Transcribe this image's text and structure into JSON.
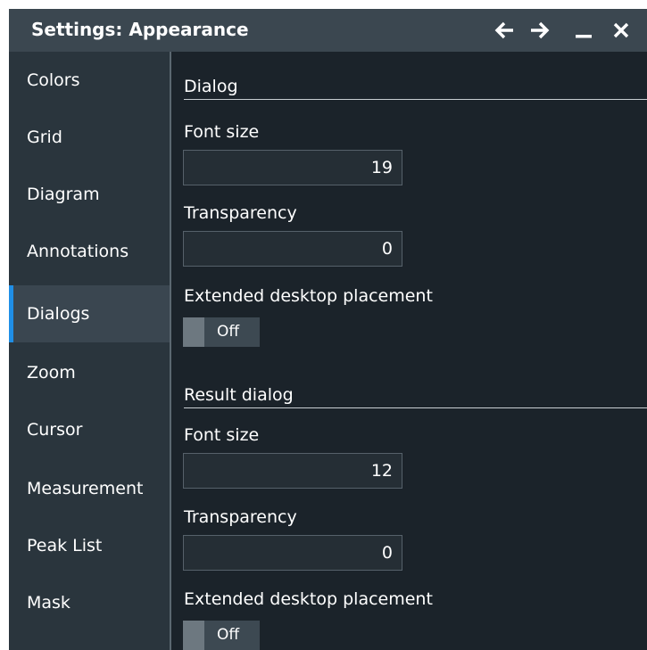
{
  "window": {
    "title": "Settings: Appearance",
    "buttons": {
      "back": "arrow-left-icon",
      "forward": "arrow-right-icon",
      "minimize": "minimize-icon",
      "close": "close-icon"
    }
  },
  "sidebar": {
    "items": [
      {
        "label": "Colors",
        "active": false
      },
      {
        "label": "Grid",
        "active": false
      },
      {
        "label": "Diagram",
        "active": false
      },
      {
        "label": "Annotations",
        "active": false
      },
      {
        "label": "Dialogs",
        "active": true
      },
      {
        "label": "Zoom",
        "active": false
      },
      {
        "label": "Cursor",
        "active": false
      },
      {
        "label": "Measurement",
        "active": false
      },
      {
        "label": "Peak List",
        "active": false
      },
      {
        "label": "Mask",
        "active": false
      }
    ]
  },
  "dialog": {
    "heading": "Dialog",
    "font_size_label": "Font size",
    "font_size_value": "19",
    "transparency_label": "Transparency",
    "transparency_value": "0",
    "placement_label": "Extended desktop placement",
    "placement_state": "Off"
  },
  "result_dialog": {
    "heading": "Result dialog",
    "font_size_label": "Font size",
    "font_size_value": "12",
    "transparency_label": "Transparency",
    "transparency_value": "0",
    "placement_label": "Extended desktop placement",
    "placement_state": "Off"
  },
  "colors": {
    "accent": "#1f8ee6",
    "titlebar": "#3b4750",
    "sidebar": "#2a353d",
    "background": "#1b232a"
  }
}
